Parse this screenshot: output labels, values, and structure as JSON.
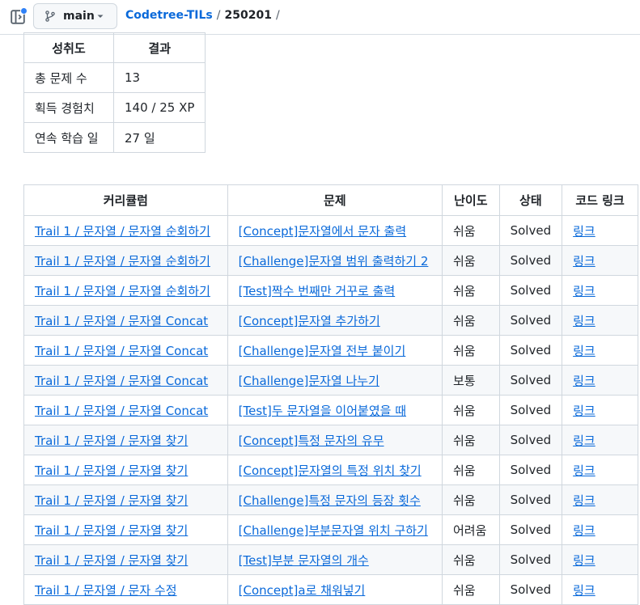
{
  "header": {
    "branch": "main",
    "repo": "Codetree-TILs",
    "separator": "/",
    "folder": "250201"
  },
  "stats_table": {
    "headers": [
      "성취도",
      "결과"
    ],
    "rows": [
      [
        "총 문제 수",
        "13"
      ],
      [
        "획득 경험치",
        "140 / 25 XP"
      ],
      [
        "연속 학습 일",
        "27 일"
      ]
    ]
  },
  "problems_table": {
    "headers": [
      "커리큘럼",
      "문제",
      "난이도",
      "상태",
      "코드 링크"
    ],
    "rows": [
      {
        "curriculum": "Trail 1 / 문자열 / 문자열 순회하기",
        "problem": "[Concept]문자열에서 문자 출력",
        "difficulty": "쉬움",
        "status": "Solved",
        "link": "링크"
      },
      {
        "curriculum": "Trail 1 / 문자열 / 문자열 순회하기",
        "problem": "[Challenge]문자열 범위 출력하기 2",
        "difficulty": "쉬움",
        "status": "Solved",
        "link": "링크"
      },
      {
        "curriculum": "Trail 1 / 문자열 / 문자열 순회하기",
        "problem": "[Test]짝수 번째만 거꾸로 출력",
        "difficulty": "쉬움",
        "status": "Solved",
        "link": "링크"
      },
      {
        "curriculum": "Trail 1 / 문자열 / 문자열 Concat",
        "problem": "[Concept]문자열 추가하기",
        "difficulty": "쉬움",
        "status": "Solved",
        "link": "링크"
      },
      {
        "curriculum": "Trail 1 / 문자열 / 문자열 Concat",
        "problem": "[Challenge]문자열 전부 붙이기",
        "difficulty": "쉬움",
        "status": "Solved",
        "link": "링크"
      },
      {
        "curriculum": "Trail 1 / 문자열 / 문자열 Concat",
        "problem": "[Challenge]문자열 나누기",
        "difficulty": "보통",
        "status": "Solved",
        "link": "링크"
      },
      {
        "curriculum": "Trail 1 / 문자열 / 문자열 Concat",
        "problem": "[Test]두 문자열을 이어붙였을 때",
        "difficulty": "쉬움",
        "status": "Solved",
        "link": "링크"
      },
      {
        "curriculum": "Trail 1 / 문자열 / 문자열 찾기",
        "problem": "[Concept]특정 문자의 유무",
        "difficulty": "쉬움",
        "status": "Solved",
        "link": "링크"
      },
      {
        "curriculum": "Trail 1 / 문자열 / 문자열 찾기",
        "problem": "[Concept]문자열의 특정 위치 찾기",
        "difficulty": "쉬움",
        "status": "Solved",
        "link": "링크"
      },
      {
        "curriculum": "Trail 1 / 문자열 / 문자열 찾기",
        "problem": "[Challenge]특정 문자의 등장 횟수",
        "difficulty": "쉬움",
        "status": "Solved",
        "link": "링크"
      },
      {
        "curriculum": "Trail 1 / 문자열 / 문자열 찾기",
        "problem": "[Challenge]부분문자열 위치 구하기",
        "difficulty": "어려움",
        "status": "Solved",
        "link": "링크"
      },
      {
        "curriculum": "Trail 1 / 문자열 / 문자열 찾기",
        "problem": "[Test]부분 문자열의 개수",
        "difficulty": "쉬움",
        "status": "Solved",
        "link": "링크"
      },
      {
        "curriculum": "Trail 1 / 문자열 / 문자 수정",
        "problem": "[Concept]a로 채워넣기",
        "difficulty": "쉬움",
        "status": "Solved",
        "link": "링크"
      }
    ]
  },
  "icons": {
    "panel_toggle": "sidebar-expand-icon",
    "branch": "git-branch-icon",
    "caret": "triangle-down-icon"
  },
  "colors": {
    "link": "#0969da",
    "notification_dot": "#2f81f7",
    "border": "#d0d7de",
    "stripe": "#f6f8fa"
  }
}
